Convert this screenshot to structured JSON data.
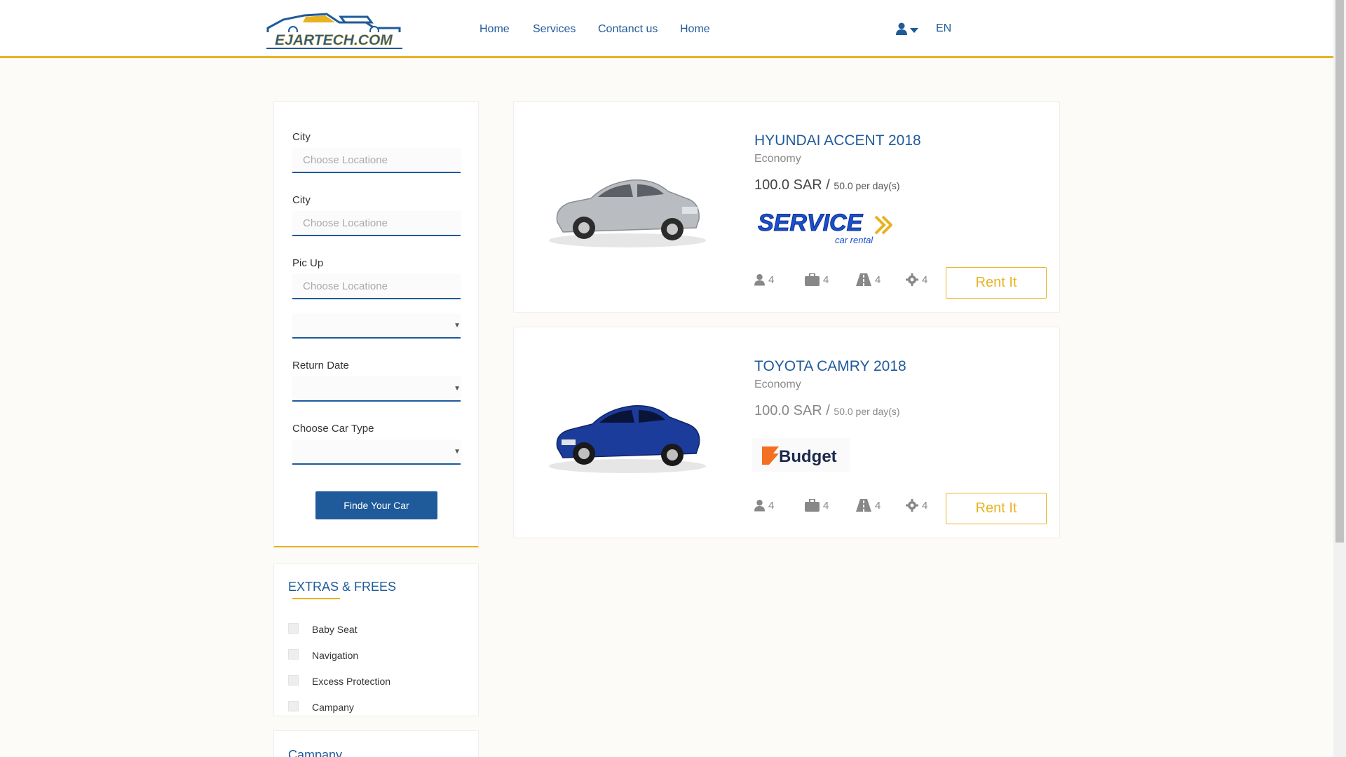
{
  "brand": {
    "logo_text": "EJARTECH.COM"
  },
  "nav": [
    {
      "label": "Home"
    },
    {
      "label": "Services"
    },
    {
      "label": "Contanct us"
    },
    {
      "label": "Home"
    }
  ],
  "user_menu": {
    "icon": "user-icon",
    "caret_icon": "caret-down-icon"
  },
  "language": "EN",
  "filters": {
    "city1": {
      "label": "City",
      "placeholder": "Choose Locatione"
    },
    "city2": {
      "label": "City",
      "placeholder": "Choose Locatione"
    },
    "pickup": {
      "label": "Pic Up",
      "placeholder": "Choose Locatione",
      "date_value": ""
    },
    "return_date": {
      "label": "Return Date",
      "value": ""
    },
    "car_type": {
      "label": "Choose Car Type",
      "value": ""
    },
    "submit_label": "Finde Your Car"
  },
  "extras": {
    "title": "EXTRAS & FREES",
    "items": [
      {
        "label": "Baby Seat",
        "checked": false
      },
      {
        "label": "Navigation",
        "checked": false
      },
      {
        "label": "Excess Protection",
        "checked": false
      },
      {
        "label": "Campany",
        "checked": false
      }
    ]
  },
  "company": {
    "title": "Campany"
  },
  "cars": [
    {
      "name": "HYUNDAI ACCENT 2018",
      "class": "Economy",
      "price": "100.0 SAR /",
      "per_day": "50.0 per day(s)",
      "company_logo": "SERVICE",
      "company_logo_sub": "car rental",
      "specs": {
        "passengers": "4",
        "bags": "4",
        "road": "4",
        "gear": "4"
      },
      "rent_label": "Rent It",
      "color": "#b9bcc0"
    },
    {
      "name": "TOYOTA CAMRY 2018",
      "class": "Economy",
      "price": "100.0 SAR /",
      "per_day": "50.0 per day(s)",
      "company_logo": "Budget",
      "specs": {
        "passengers": "4",
        "bags": "4",
        "road": "4",
        "gear": "4"
      },
      "rent_label": "Rent It",
      "color": "#1c3c9c"
    }
  ],
  "colors": {
    "primary": "#1f5a9a",
    "accent": "#e8b322",
    "background": "#fcfbf8"
  }
}
